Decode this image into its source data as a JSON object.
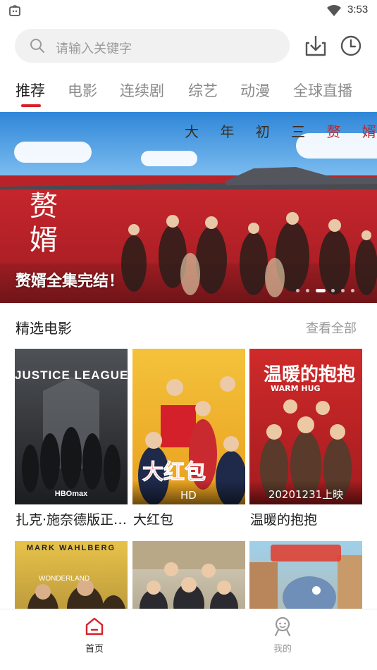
{
  "status_bar": {
    "time": "3:53"
  },
  "search": {
    "placeholder": "请输入关键字"
  },
  "header_icons": {
    "download": "download-icon",
    "history": "clock-history-icon"
  },
  "tabs": [
    {
      "label": "推荐",
      "active": true
    },
    {
      "label": "电影",
      "active": false
    },
    {
      "label": "连续剧",
      "active": false
    },
    {
      "label": "综艺",
      "active": false
    },
    {
      "label": "动漫",
      "active": false
    },
    {
      "label": "全球直播",
      "active": false
    }
  ],
  "banner": {
    "tagline_a": "大 年 初 三",
    "tagline_b": "赘 婿 请",
    "logo_text": "赘婿",
    "caption": "赘婿全集完结！",
    "slide_count": 6,
    "active_slide": 2
  },
  "section": {
    "title": "精选电影",
    "more_label": "查看全部"
  },
  "movies": [
    {
      "title": "扎克·施奈德版正…",
      "poster_text": "JUSTICE LEAGUE",
      "poster_sub": "HBOmax",
      "badge": ""
    },
    {
      "title": "大红包",
      "poster_text": "大红包",
      "poster_sub": "",
      "badge": "HD"
    },
    {
      "title": "温暖的抱抱",
      "poster_text": "温暖的抱抱",
      "poster_sub": "WARM HUG",
      "badge": "20201231上映"
    }
  ],
  "row2_posters": [
    {
      "poster_text": "MARK WAHLBERG",
      "poster_sub": "WONDERLAND"
    },
    {
      "poster_text": "",
      "poster_sub": ""
    },
    {
      "poster_text": "",
      "poster_sub": ""
    }
  ],
  "bottom_nav": [
    {
      "label": "首页",
      "icon": "home-icon",
      "active": true
    },
    {
      "label": "我的",
      "icon": "profile-icon",
      "active": false
    }
  ],
  "colors": {
    "accent": "#d8202a",
    "inactive_text": "#8a8a8a",
    "nav_inactive": "#9a9a9a"
  }
}
